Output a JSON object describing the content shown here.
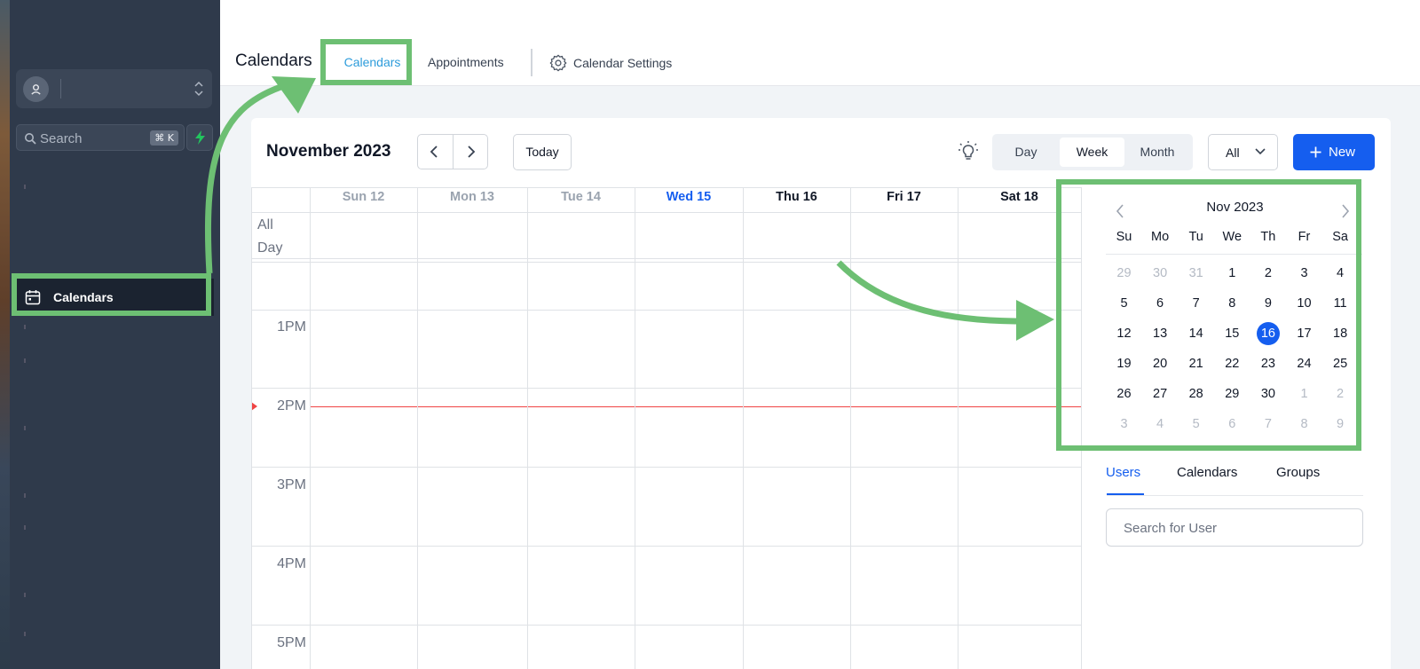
{
  "sidebar": {
    "search_placeholder": "Search",
    "search_shortcut": "⌘ K",
    "nav_calendars": "Calendars"
  },
  "header": {
    "title": "Calendars",
    "tab_calendars": "Calendars",
    "tab_appointments": "Appointments",
    "tab_settings": "Calendar Settings"
  },
  "toolbar": {
    "month_label": "November 2023",
    "today_label": "Today",
    "view_day": "Day",
    "view_week": "Week",
    "view_month": "Month",
    "selected_view": "Week",
    "filter_value": "All",
    "new_label": "New"
  },
  "week": {
    "days": [
      {
        "label": "Sun 12",
        "style": "past"
      },
      {
        "label": "Mon 13",
        "style": "past"
      },
      {
        "label": "Tue 14",
        "style": "past"
      },
      {
        "label": "Wed 15",
        "style": "today"
      },
      {
        "label": "Thu 16",
        "style": "future"
      },
      {
        "label": "Fri 17",
        "style": "future"
      },
      {
        "label": "Sat 18",
        "style": "future"
      }
    ],
    "all_day_label": "All Day",
    "hours": [
      "1PM",
      "2PM",
      "3PM",
      "4PM",
      "5PM"
    ]
  },
  "mini_calendar": {
    "title": "Nov 2023",
    "weekdays": [
      "Su",
      "Mo",
      "Tu",
      "We",
      "Th",
      "Fr",
      "Sa"
    ],
    "weeks": [
      [
        "29",
        "30",
        "31",
        "1",
        "2",
        "3",
        "4"
      ],
      [
        "5",
        "6",
        "7",
        "8",
        "9",
        "10",
        "11"
      ],
      [
        "12",
        "13",
        "14",
        "15",
        "16",
        "17",
        "18"
      ],
      [
        "19",
        "20",
        "21",
        "22",
        "23",
        "24",
        "25"
      ],
      [
        "26",
        "27",
        "28",
        "29",
        "30",
        "1",
        "2"
      ],
      [
        "3",
        "4",
        "5",
        "6",
        "7",
        "8",
        "9"
      ]
    ],
    "selected_day": "16"
  },
  "panel": {
    "tabs": [
      "Users",
      "Calendars",
      "Groups"
    ],
    "active_tab": "Users",
    "search_placeholder": "Search for User"
  },
  "colors": {
    "primary": "#155eef",
    "highlight": "#6dbf73",
    "sidebar": "#2f3a4b",
    "now_line": "#ef4444"
  }
}
